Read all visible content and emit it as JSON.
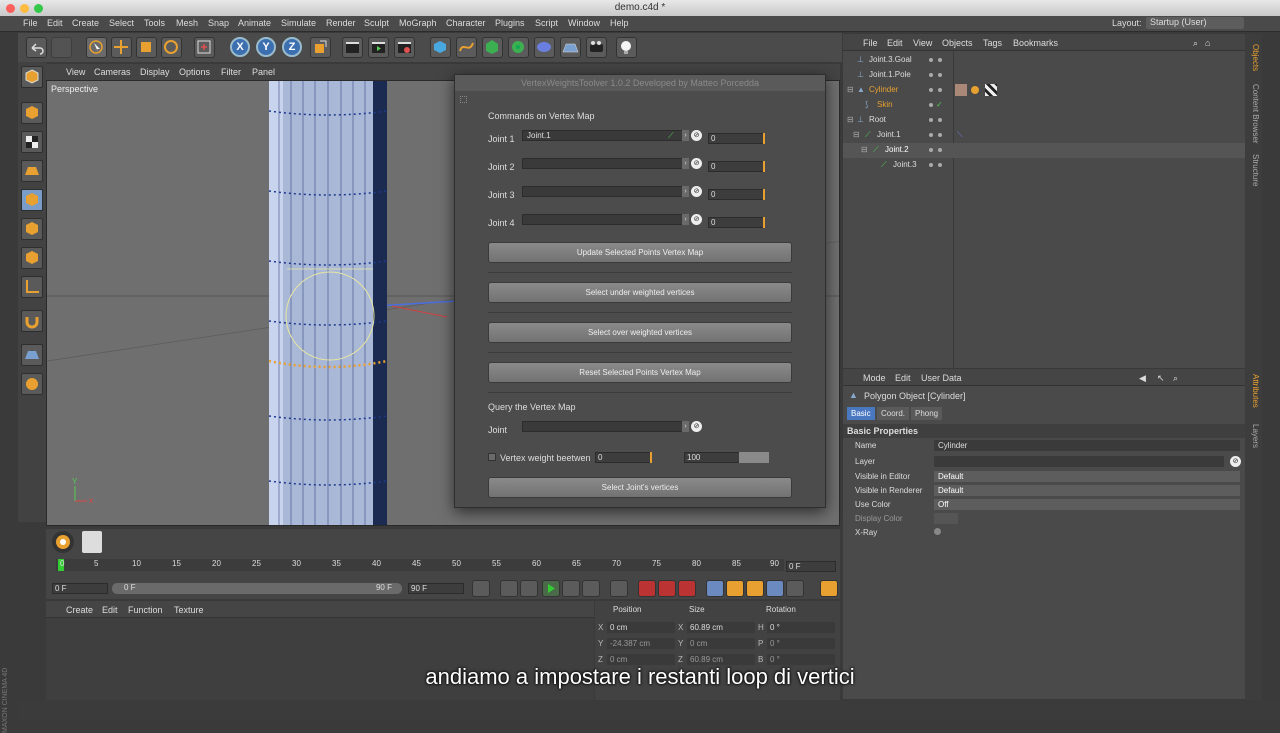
{
  "window": {
    "title": "demo.c4d *"
  },
  "menubar": {
    "items": [
      "File",
      "Edit",
      "Create",
      "Select",
      "Tools",
      "Mesh",
      "Snap",
      "Animate",
      "Simulate",
      "Render",
      "Sculpt",
      "MoGraph",
      "Character",
      "Plugins",
      "Script",
      "Window",
      "Help"
    ],
    "layout_label": "Layout:",
    "layout_value": "Startup (User)"
  },
  "viewport": {
    "menu": [
      "View",
      "Cameras",
      "Display",
      "Options",
      "Filter",
      "Panel"
    ],
    "label": "Perspective",
    "axis_y": "Y",
    "axis_x": "x"
  },
  "dialog": {
    "title": "VertexWeightsToolver 1.0.2 Developed by Matteo Porcedda",
    "section1": "Commands on Vertex Map",
    "joints": [
      {
        "label": "Joint 1",
        "link": "Joint.1",
        "value": "0"
      },
      {
        "label": "Joint 2",
        "link": "",
        "value": "0"
      },
      {
        "label": "Joint 3",
        "link": "",
        "value": "0"
      },
      {
        "label": "Joint 4",
        "link": "",
        "value": "0"
      }
    ],
    "buttons": [
      "Update Selected Points Vertex Map",
      "Select under weighted vertices",
      "Select over weighted vertices",
      "Reset Selected Points Vertex Map"
    ],
    "section2": "Query the Vertex Map",
    "query_joint_label": "Joint",
    "between_label": "Vertex weight beetwen",
    "between_min": "0",
    "between_max": "100",
    "select_button": "Select Joint's vertices"
  },
  "objects": {
    "menu": [
      "File",
      "Edit",
      "View",
      "Objects",
      "Tags",
      "Bookmarks"
    ],
    "rows": [
      "Joint.3.Goal",
      "Joint.1.Pole",
      "Cylinder",
      "Skin",
      "Root",
      "Joint.1",
      "Joint.2",
      "Joint.3"
    ]
  },
  "attributes": {
    "menu": [
      "Mode",
      "Edit",
      "User Data"
    ],
    "object_title": "Polygon Object [Cylinder]",
    "tabs": [
      "Basic",
      "Coord.",
      "Phong"
    ],
    "section": "Basic Properties",
    "props": [
      {
        "label": "Name",
        "value": "Cylinder"
      },
      {
        "label": "Layer",
        "value": ""
      },
      {
        "label": "Visible in Editor",
        "value": "Default"
      },
      {
        "label": "Visible in Renderer",
        "value": "Default"
      },
      {
        "label": "Use Color",
        "value": "Off"
      },
      {
        "label": "Display Color",
        "value": ""
      },
      {
        "label": "X-Ray",
        "value": ""
      }
    ]
  },
  "right_tabs": [
    "Objects",
    "Content Browser",
    "Structure",
    "Attributes",
    "Layers"
  ],
  "timeline": {
    "ticks": [
      "0",
      "5",
      "10",
      "15",
      "20",
      "25",
      "30",
      "35",
      "40",
      "45",
      "50",
      "55",
      "60",
      "65",
      "70",
      "75",
      "80",
      "85",
      "90"
    ],
    "current_frame": "0 F",
    "start": "0 F",
    "range_start": "0 F",
    "range_end": "90 F",
    "end": "90 F"
  },
  "materials": {
    "menu": [
      "Create",
      "Edit",
      "Function",
      "Texture"
    ]
  },
  "coords": {
    "headers": [
      "Position",
      "Size",
      "Rotation"
    ],
    "rows": [
      {
        "axis": "X",
        "pos": "0 cm",
        "saxis": "X",
        "size": "60.89 cm",
        "raxis": "H",
        "rot": "0 °"
      },
      {
        "axis": "Y",
        "pos": "-24.387 cm",
        "saxis": "Y",
        "size": "0 cm",
        "raxis": "P",
        "rot": "0 °"
      },
      {
        "axis": "Z",
        "pos": "0 cm",
        "saxis": "Z",
        "size": "60.89 cm",
        "raxis": "B",
        "rot": "0 °"
      }
    ]
  },
  "branding": {
    "logo_text": "MAXON CINEMA 4D"
  },
  "subtitle": "andiamo a impostare i restanti loop di vertici",
  "colors": {
    "accent_orange": "#e8a030",
    "selection_blue": "#4a78c0",
    "cylinder": "#aab8d8"
  }
}
